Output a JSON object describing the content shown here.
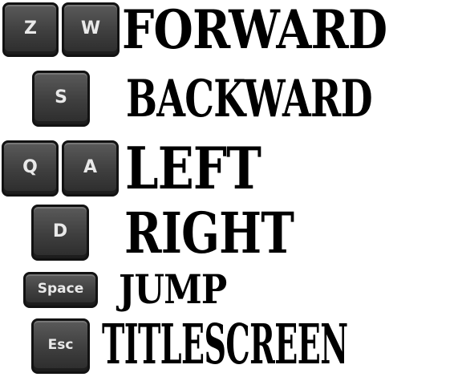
{
  "controls": [
    {
      "keys": [
        "Z",
        "W"
      ],
      "action": "FORWARD"
    },
    {
      "keys": [
        "S"
      ],
      "action": "BACKWARD"
    },
    {
      "keys": [
        "Q",
        "A"
      ],
      "action": "LEFT"
    },
    {
      "keys": [
        "D"
      ],
      "action": "RIGHT"
    },
    {
      "keys": [
        "Space"
      ],
      "action": "JUMP"
    },
    {
      "keys": [
        "Esc"
      ],
      "action": "TITLESCREEN"
    }
  ],
  "colors": {
    "key_face": "#444444",
    "key_label": "#e9e9e9",
    "text": "#000000",
    "background": "#ffffff"
  }
}
